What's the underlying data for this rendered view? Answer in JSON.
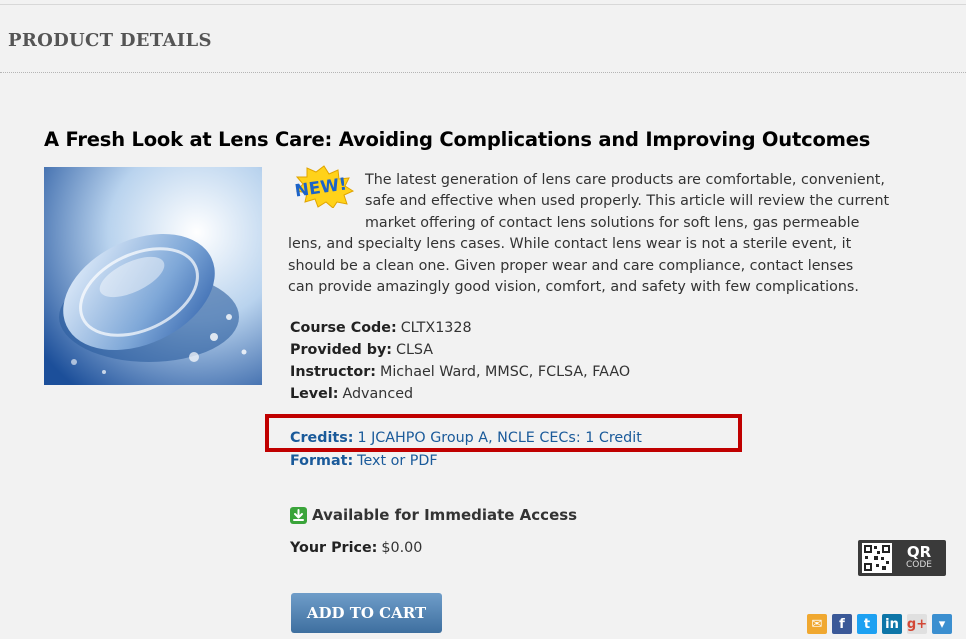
{
  "section": {
    "header": "PRODUCT DETAILS"
  },
  "product": {
    "title": "A Fresh Look at Lens Care: Avoiding Complications and Improving Outcomes",
    "badge": "NEW!",
    "description_lines": [
      "The latest generation of lens care products are comfortable, convenient,",
      "safe and effective when used properly. This article will review the current",
      "market offering of contact lens solutions for soft lens, gas permeable",
      "lens, and specialty lens cases. While contact lens wear is not a sterile event, it",
      "should be a clean one. Given proper wear and care compliance, contact lenses",
      "can provide amazingly good vision, comfort, and safety with few complications."
    ],
    "details": [
      {
        "label": "Course Code:",
        "value": "CLTX1328"
      },
      {
        "label": "Provided by:",
        "value": "CLSA"
      },
      {
        "label": "Instructor:",
        "value": "Michael Ward, MMSC, FCLSA, FAAO"
      },
      {
        "label": "Level:",
        "value": "Advanced"
      }
    ],
    "credits": {
      "label": "Credits:",
      "value": "1 JCAHPO Group A, NCLE CECs: 1 Credit"
    },
    "format": {
      "label": "Format:",
      "value": "Text or PDF"
    },
    "availability": "Available for Immediate Access",
    "price": {
      "label": "Your Price:",
      "value": "$0.00"
    },
    "add_to_cart": "ADD TO CART"
  },
  "qr": {
    "big": "QR",
    "small": "CODE"
  },
  "share": [
    {
      "icon": "email-icon",
      "color": "#f0a830",
      "glyph": "✉"
    },
    {
      "icon": "facebook-icon",
      "color": "#3b5998",
      "glyph": "f"
    },
    {
      "icon": "twitter-icon",
      "color": "#1da1f2",
      "glyph": "t"
    },
    {
      "icon": "linkedin-icon",
      "color": "#0e76a8",
      "glyph": "in"
    },
    {
      "icon": "google-plus-icon",
      "color": "#e0e0e0",
      "glyph": "g+"
    },
    {
      "icon": "more-share-icon",
      "color": "#3b8fd0",
      "glyph": "▾"
    }
  ],
  "colors": {
    "link": "#1a5a9a",
    "highlight": "#c00000",
    "button": "#4f82b3",
    "available": "#3aa43a"
  }
}
